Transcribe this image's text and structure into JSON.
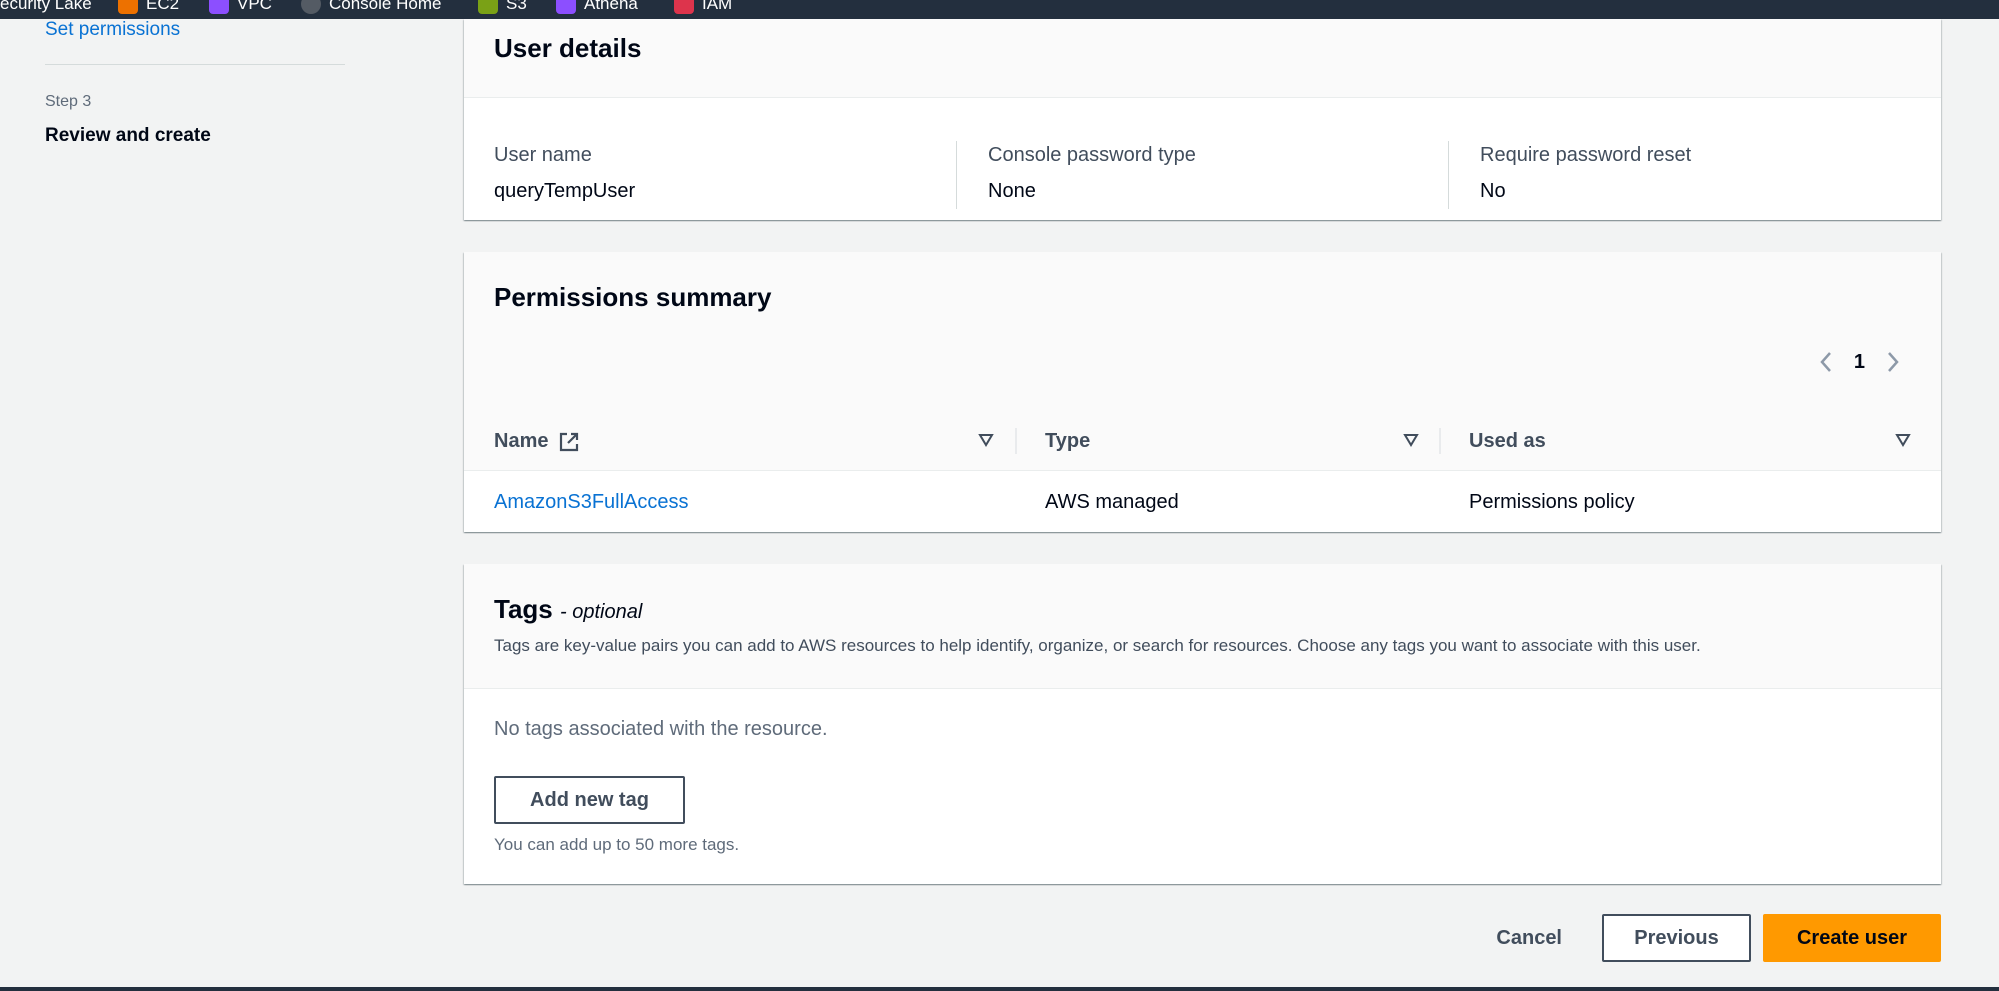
{
  "topbar": {
    "bookmarks": [
      {
        "label": "ecurity Lake",
        "icon": "security-lake-icon",
        "color": "#232f3e"
      },
      {
        "label": "EC2",
        "icon": "ec2-icon",
        "color": "#ed7100"
      },
      {
        "label": "VPC",
        "icon": "vpc-icon",
        "color": "#8c4fff"
      },
      {
        "label": "Console Home",
        "icon": "console-home-icon",
        "color": "#545b64"
      },
      {
        "label": "S3",
        "icon": "s3-icon",
        "color": "#7aa116"
      },
      {
        "label": "Athena",
        "icon": "athena-icon",
        "color": "#8c4fff"
      },
      {
        "label": "IAM",
        "icon": "iam-icon",
        "color": "#dd344c"
      }
    ]
  },
  "wizard": {
    "prev_step_link": "Set permissions",
    "step_label": "Step 3",
    "step_title": "Review and create"
  },
  "user_details": {
    "title": "User details",
    "fields": [
      {
        "label": "User name",
        "value": "queryTempUser"
      },
      {
        "label": "Console password type",
        "value": "None"
      },
      {
        "label": "Require password reset",
        "value": "No"
      }
    ]
  },
  "permissions": {
    "title": "Permissions summary",
    "page": "1",
    "columns": [
      "Name",
      "Type",
      "Used as"
    ],
    "rows": [
      {
        "name": "AmazonS3FullAccess",
        "type": "AWS managed",
        "used_as": "Permissions policy"
      }
    ]
  },
  "tags": {
    "title": "Tags",
    "optional": "- optional",
    "description": "Tags are key-value pairs you can add to AWS resources to help identify, organize, or search for resources. Choose any tags you want to associate with this user.",
    "empty_text": "No tags associated with the resource.",
    "add_button": "Add new tag",
    "hint": "You can add up to 50 more tags."
  },
  "actions": {
    "cancel": "Cancel",
    "previous": "Previous",
    "create": "Create user"
  },
  "colors": {
    "primary": "#ff9900",
    "link": "#0972d3",
    "nav_bg": "#232f3e"
  }
}
